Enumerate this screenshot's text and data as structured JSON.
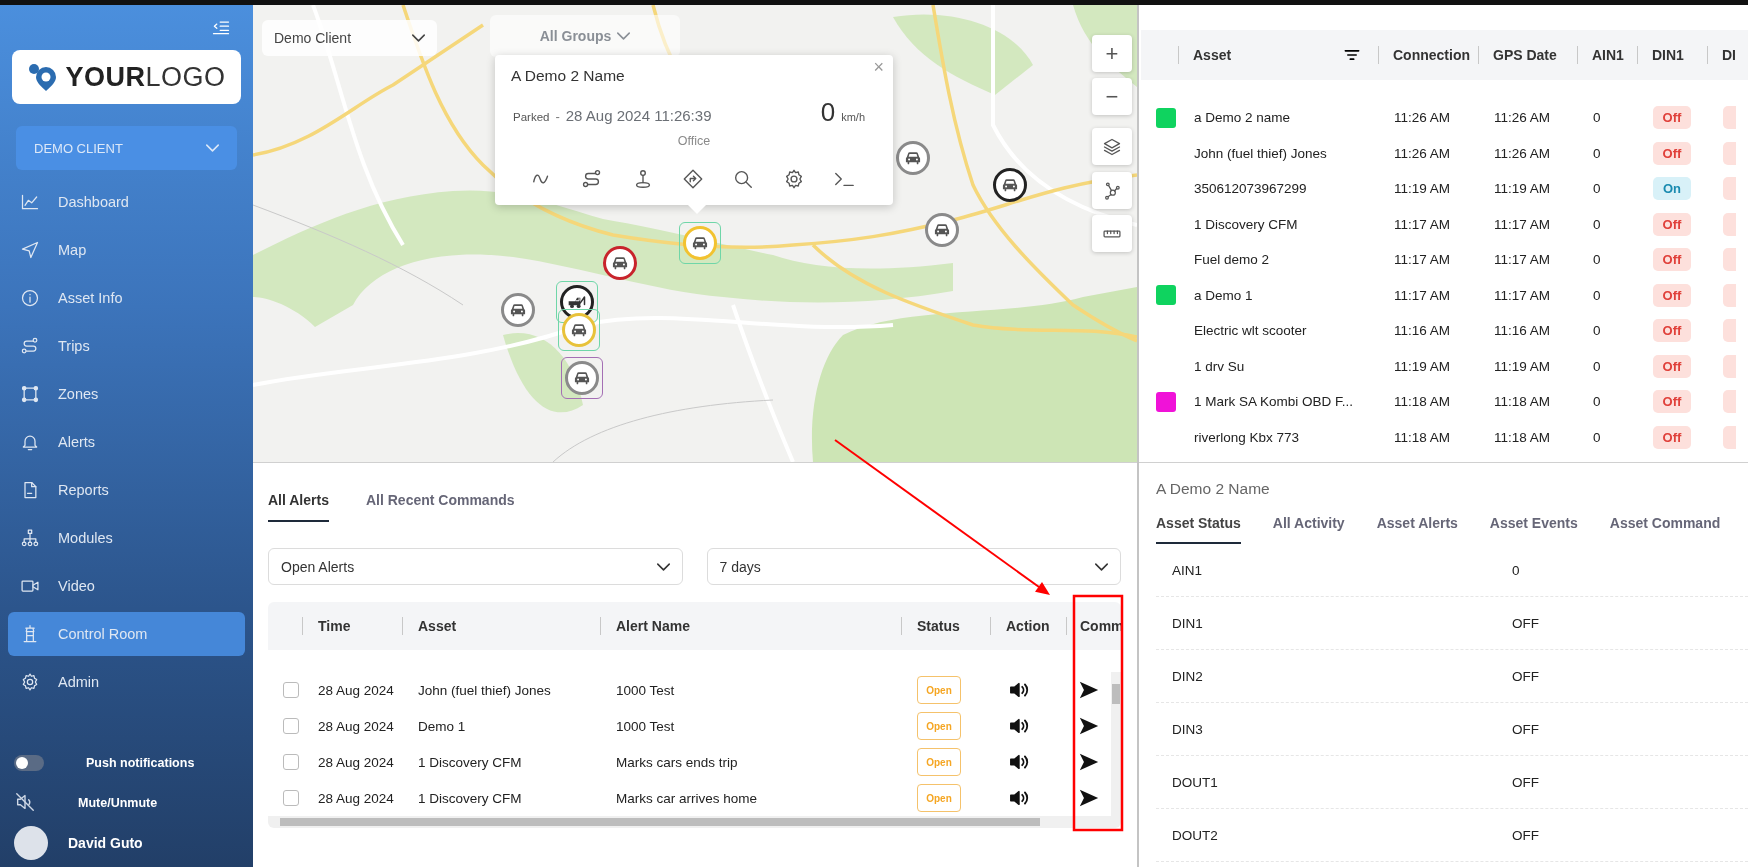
{
  "sidebar": {
    "logo": "**YOUR**LOGO",
    "client_selector": "DEMO CLIENT",
    "nav_items": [
      {
        "label": "Dashboard",
        "selected": false
      },
      {
        "label": "Map",
        "selected": false
      },
      {
        "label": "Asset Info",
        "selected": false
      },
      {
        "label": "Trips",
        "selected": false
      },
      {
        "label": "Zones",
        "selected": false
      },
      {
        "label": "Alerts",
        "selected": false
      },
      {
        "label": "Reports",
        "selected": false
      },
      {
        "label": "Modules",
        "selected": false
      },
      {
        "label": "Video",
        "selected": false
      },
      {
        "label": "Control Room",
        "selected": true
      },
      {
        "label": "Admin",
        "selected": false
      }
    ],
    "push_notifications": {
      "label": "Push notifications",
      "on": false
    },
    "mute": {
      "label": "Mute/Unmute"
    },
    "user": {
      "name": "David Guto"
    }
  },
  "map": {
    "client_filter": "Demo Client",
    "group_filter": "All Groups",
    "zoom_in": "+",
    "zoom_out": "−",
    "popup": {
      "title": "A Demo 2 Name",
      "status": "Parked",
      "separator": "-",
      "timestamp": "28 Aug 2024 11:26:39",
      "speed": "0",
      "speed_unit": "km/h",
      "location": "Office",
      "close": "×"
    },
    "markers": [
      {
        "kind": "car",
        "color": "#f2c230",
        "frame": {
          "color": "#6fd6a8"
        }
      },
      {
        "kind": "car",
        "color": "#c8242c"
      },
      {
        "kind": "car",
        "color": "#8a8a8a"
      },
      {
        "kind": "tow-truck",
        "color": "#222222",
        "frame": {
          "color": "#6fd6a8"
        }
      },
      {
        "kind": "car",
        "color": "#e8c23a",
        "frame": {
          "color": "#6fd6a8"
        }
      },
      {
        "kind": "car",
        "color": "#8a8a8a",
        "frame": {
          "color": "#a46fb4"
        }
      },
      {
        "kind": "car",
        "color": "#8a8a8a"
      },
      {
        "kind": "car",
        "color": "#222222"
      },
      {
        "kind": "car",
        "color": "#8a8a8a"
      }
    ]
  },
  "alerts_panel": {
    "tabs": [
      {
        "label": "All Alerts",
        "selected": true
      },
      {
        "label": "All Recent Commands",
        "selected": false
      }
    ],
    "filters": [
      {
        "value": "Open Alerts"
      },
      {
        "value": "7 days"
      }
    ],
    "table": {
      "columns": [
        "Time",
        "Asset",
        "Alert Name",
        "Status",
        "Action",
        "Comm"
      ],
      "rows": [
        {
          "checked": false,
          "time": "28 Aug 2024",
          "asset": "John (fuel thief) Jones",
          "alert_name": "1000 Test",
          "status": "Open"
        },
        {
          "checked": false,
          "time": "28 Aug 2024",
          "asset": "Demo 1",
          "alert_name": "1000 Test",
          "status": "Open"
        },
        {
          "checked": false,
          "time": "28 Aug 2024",
          "asset": "1 Discovery CFM",
          "alert_name": "Marks cars ends trip",
          "status": "Open"
        },
        {
          "checked": false,
          "time": "28 Aug 2024",
          "asset": "1 Discovery CFM",
          "alert_name": "Marks car arrives home",
          "status": "Open"
        }
      ]
    }
  },
  "assets_table": {
    "columns": [
      "Asset",
      "Connection",
      "GPS Date",
      "AIN1",
      "DIN1",
      "DI"
    ],
    "rows": [
      {
        "color": "#0fd35f",
        "asset": "a Demo 2 name",
        "connection": "11:26 AM",
        "gps_date": "11:26 AM",
        "ain1": "0",
        "din1": "Off",
        "din1_on": false,
        "column_7_on": false
      },
      {
        "asset": "John (fuel thief) Jones",
        "connection": "11:26 AM",
        "gps_date": "11:26 AM",
        "ain1": "0",
        "din1": "Off",
        "din1_on": false,
        "column_7_on": false
      },
      {
        "asset": "350612073967299",
        "connection": "11:19 AM",
        "gps_date": "11:19 AM",
        "ain1": "0",
        "din1": "On",
        "din1_on": true,
        "column_7_on": false
      },
      {
        "asset": "1 Discovery CFM",
        "connection": "11:17 AM",
        "gps_date": "11:17 AM",
        "ain1": "0",
        "din1": "Off",
        "din1_on": false,
        "column_7_on": false
      },
      {
        "asset": "Fuel demo 2",
        "connection": "11:17 AM",
        "gps_date": "11:17 AM",
        "ain1": "0",
        "din1": "Off",
        "din1_on": false,
        "column_7_on": false
      },
      {
        "color": "#0fd35f",
        "asset": "a Demo 1",
        "connection": "11:17 AM",
        "gps_date": "11:17 AM",
        "ain1": "0",
        "din1": "Off",
        "din1_on": false,
        "column_7_on": false
      },
      {
        "asset": "Electric wlt scooter",
        "connection": "11:16 AM",
        "gps_date": "11:16 AM",
        "ain1": "0",
        "din1": "Off",
        "din1_on": false,
        "column_7_on": false
      },
      {
        "asset": "1 drv Su",
        "connection": "11:19 AM",
        "gps_date": "11:19 AM",
        "ain1": "0",
        "din1": "Off",
        "din1_on": false,
        "column_7_on": false
      },
      {
        "color": "#f012d8",
        "asset": "1 Mark SA Kombi OBD F...",
        "connection": "11:18 AM",
        "gps_date": "11:18 AM",
        "ain1": "0",
        "din1": "Off",
        "din1_on": false,
        "column_7_on": false
      },
      {
        "asset": "riverlong Kbx 773",
        "connection": "11:18 AM",
        "gps_date": "11:18 AM",
        "ain1": "0",
        "din1": "Off",
        "din1_on": false,
        "column_7_on": false
      }
    ]
  },
  "asset_detail": {
    "title": "A Demo 2 Name",
    "tabs": [
      {
        "label": "Asset Status",
        "selected": true
      },
      {
        "label": "All Activity",
        "selected": false
      },
      {
        "label": "Asset Alerts",
        "selected": false
      },
      {
        "label": "Asset Events",
        "selected": false
      },
      {
        "label": "Asset Command",
        "selected": false
      }
    ],
    "status_rows": [
      {
        "name": "AIN1",
        "value": "0"
      },
      {
        "name": "DIN1",
        "value": "OFF"
      },
      {
        "name": "DIN2",
        "value": "OFF"
      },
      {
        "name": "DIN3",
        "value": "OFF"
      },
      {
        "name": "DOUT1",
        "value": "OFF"
      },
      {
        "name": "DOUT2",
        "value": "OFF"
      }
    ]
  }
}
